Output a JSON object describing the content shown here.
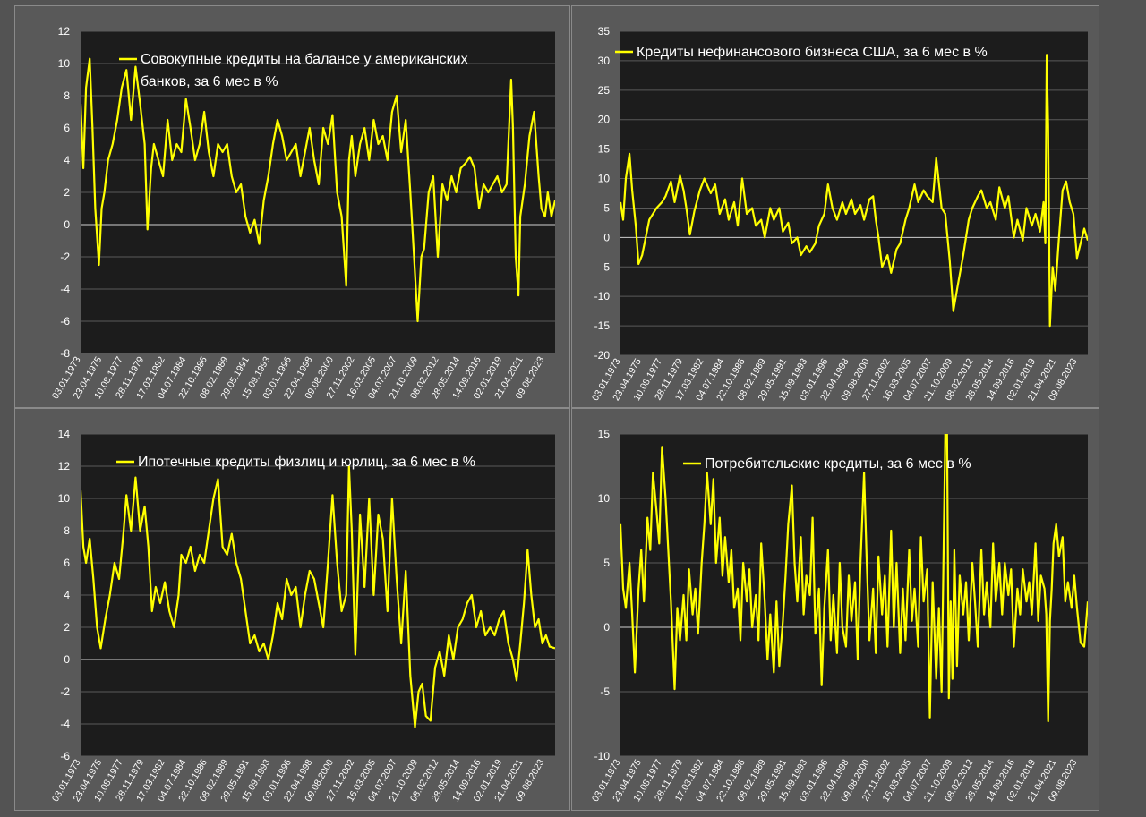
{
  "colors": {
    "series": "#ffff00",
    "plot_bg": "#1c1c1c",
    "grid": "#5a5a5a",
    "zero": "#cfcfcf",
    "text": "#ffffff"
  },
  "date_ticks": [
    "03.01.1973",
    "23.04.1975",
    "10.08.1977",
    "28.11.1979",
    "17.03.1982",
    "04.07.1984",
    "22.10.1986",
    "08.02.1989",
    "29.05.1991",
    "15.09.1993",
    "03.01.1996",
    "22.04.1998",
    "09.08.2000",
    "27.11.2002",
    "16.03.2005",
    "04.07.2007",
    "21.10.2009",
    "08.02.2012",
    "28.05.2014",
    "14.09.2016",
    "02.01.2019",
    "21.04.2021",
    "09.08.2023"
  ],
  "chart_data": [
    {
      "type": "line",
      "title_lines": [
        "Совокупные кредиты на балансе у американских",
        "банков, за 6 мес в %"
      ],
      "series_name": "Совокупные кредиты на балансе у американских банков, за 6 мес в %",
      "ylim": [
        -8,
        12
      ],
      "yticks": [
        -8,
        -6,
        -4,
        -2,
        0,
        2,
        4,
        6,
        8,
        10,
        12
      ],
      "x_range": [
        1973.0,
        2024.8
      ],
      "x": [
        1973.0,
        1973.3,
        1973.6,
        1974.0,
        1974.3,
        1974.6,
        1975.0,
        1975.3,
        1975.6,
        1976.0,
        1976.5,
        1977.0,
        1977.5,
        1978.0,
        1978.5,
        1979.0,
        1979.5,
        1980.0,
        1980.3,
        1980.7,
        1981.0,
        1981.5,
        1982.0,
        1982.5,
        1983.0,
        1983.5,
        1984.0,
        1984.5,
        1985.0,
        1985.5,
        1986.0,
        1986.5,
        1987.0,
        1987.5,
        1988.0,
        1988.5,
        1989.0,
        1989.5,
        1990.0,
        1990.5,
        1991.0,
        1991.5,
        1992.0,
        1992.5,
        1993.0,
        1993.5,
        1994.0,
        1994.5,
        1995.0,
        1995.5,
        1996.0,
        1996.5,
        1997.0,
        1997.5,
        1998.0,
        1998.5,
        1999.0,
        1999.5,
        2000.0,
        2000.5,
        2001.0,
        2001.5,
        2002.0,
        2002.3,
        2002.6,
        2003.0,
        2003.5,
        2004.0,
        2004.5,
        2005.0,
        2005.5,
        2006.0,
        2006.5,
        2007.0,
        2007.5,
        2008.0,
        2008.5,
        2009.0,
        2009.5,
        2009.8,
        2010.2,
        2010.5,
        2011.0,
        2011.5,
        2012.0,
        2012.5,
        2013.0,
        2013.5,
        2014.0,
        2014.5,
        2015.0,
        2015.5,
        2016.0,
        2016.5,
        2017.0,
        2017.5,
        2018.0,
        2018.5,
        2019.0,
        2019.5,
        2020.0,
        2020.2,
        2020.5,
        2020.8,
        2021.0,
        2021.5,
        2022.0,
        2022.5,
        2023.0,
        2023.3,
        2023.7,
        2024.0,
        2024.4,
        2024.8
      ],
      "y": [
        7.5,
        3.5,
        8.5,
        10.3,
        6.0,
        1.0,
        -2.5,
        1.0,
        2.0,
        4.0,
        5.0,
        6.5,
        8.5,
        9.6,
        6.5,
        9.8,
        7.5,
        5.0,
        -0.3,
        3.5,
        5.0,
        4.0,
        3.0,
        6.5,
        4.0,
        5.0,
        4.5,
        7.8,
        6.0,
        4.0,
        5.0,
        7.0,
        4.5,
        3.0,
        5.0,
        4.5,
        5.0,
        3.0,
        2.0,
        2.5,
        0.5,
        -0.5,
        0.3,
        -1.2,
        1.5,
        3.0,
        5.0,
        6.5,
        5.5,
        4.0,
        4.5,
        5.0,
        3.0,
        4.5,
        6.0,
        4.0,
        2.5,
        6.0,
        5.0,
        6.8,
        2.0,
        0.5,
        -3.8,
        4.0,
        5.5,
        3.0,
        5.0,
        6.0,
        4.0,
        6.5,
        5.0,
        5.5,
        4.0,
        7.0,
        8.0,
        4.5,
        6.5,
        2.0,
        -3.0,
        -6.0,
        -2.0,
        -1.5,
        2.0,
        3.0,
        -2.0,
        2.5,
        1.5,
        3.0,
        2.0,
        3.5,
        3.8,
        4.2,
        3.5,
        1.0,
        2.5,
        2.0,
        2.5,
        3.0,
        2.0,
        2.5,
        9.0,
        6.0,
        -2.0,
        -4.4,
        0.5,
        2.5,
        5.5,
        7.0,
        3.0,
        1.0,
        0.5,
        2.0,
        0.5,
        1.5
      ]
    },
    {
      "type": "line",
      "title_lines": [
        "Кредиты нефинансового бизнеса США, за 6 мес в %"
      ],
      "series_name": "Кредиты нефинансового бизнеса США, за 6 мес в %",
      "ylim": [
        -20,
        35
      ],
      "yticks": [
        -20,
        -15,
        -10,
        -5,
        0,
        5,
        10,
        15,
        20,
        25,
        30,
        35
      ],
      "x_range": [
        1973.0,
        2024.8
      ],
      "x": [
        1973.0,
        1973.3,
        1973.6,
        1974.0,
        1974.3,
        1974.7,
        1975.0,
        1975.4,
        1975.8,
        1976.2,
        1977.0,
        1977.6,
        1978.0,
        1978.6,
        1979.0,
        1979.6,
        1980.0,
        1980.3,
        1980.7,
        1981.2,
        1981.8,
        1982.3,
        1983.0,
        1983.5,
        1984.0,
        1984.6,
        1985.0,
        1985.6,
        1986.0,
        1986.5,
        1987.0,
        1987.6,
        1988.0,
        1988.6,
        1989.0,
        1989.6,
        1990.0,
        1990.6,
        1991.0,
        1991.6,
        1992.0,
        1992.6,
        1993.0,
        1993.6,
        1994.0,
        1994.6,
        1995.0,
        1995.6,
        1996.0,
        1996.5,
        1997.0,
        1997.6,
        1998.0,
        1998.6,
        1999.0,
        1999.6,
        2000.0,
        2000.6,
        2001.0,
        2001.3,
        2001.6,
        2002.0,
        2002.6,
        2003.0,
        2003.6,
        2004.0,
        2004.6,
        2005.0,
        2005.6,
        2006.0,
        2006.6,
        2007.0,
        2007.6,
        2008.0,
        2008.6,
        2009.0,
        2009.5,
        2009.9,
        2010.4,
        2011.0,
        2011.6,
        2012.0,
        2012.6,
        2013.0,
        2013.6,
        2014.0,
        2014.6,
        2015.0,
        2015.6,
        2016.0,
        2016.6,
        2017.0,
        2017.6,
        2018.0,
        2018.6,
        2019.0,
        2019.5,
        2019.9,
        2020.1,
        2020.25,
        2020.4,
        2020.6,
        2020.9,
        2021.2,
        2021.6,
        2022.0,
        2022.4,
        2022.8,
        2023.2,
        2023.6,
        2024.0,
        2024.4,
        2024.8
      ],
      "y": [
        6.0,
        3.0,
        10.0,
        14.2,
        8.0,
        2.0,
        -4.5,
        -3.0,
        0.0,
        3.0,
        5.0,
        6.0,
        7.0,
        9.5,
        6.0,
        10.5,
        8.0,
        5.0,
        0.5,
        4.5,
        8.0,
        10.0,
        7.5,
        9.0,
        4.0,
        6.5,
        3.0,
        6.0,
        2.0,
        10.0,
        4.0,
        5.0,
        2.0,
        3.0,
        0.0,
        5.0,
        3.0,
        5.0,
        1.0,
        2.5,
        -1.0,
        0.0,
        -3.0,
        -1.5,
        -2.5,
        -1.0,
        2.0,
        4.0,
        9.0,
        5.0,
        3.0,
        6.0,
        4.0,
        6.5,
        4.0,
        5.5,
        3.0,
        6.5,
        7.0,
        3.0,
        0.0,
        -5.0,
        -3.0,
        -6.0,
        -2.0,
        -1.0,
        3.0,
        5.0,
        9.0,
        6.0,
        8.0,
        7.0,
        6.0,
        13.5,
        5.0,
        4.0,
        -4.0,
        -12.5,
        -8.0,
        -3.0,
        3.0,
        5.0,
        7.0,
        8.0,
        5.0,
        6.0,
        3.0,
        8.5,
        5.0,
        7.0,
        0.0,
        3.0,
        -0.5,
        5.0,
        2.0,
        4.0,
        1.0,
        6.0,
        -1.0,
        31.0,
        19.0,
        -15.0,
        -5.0,
        -9.0,
        0.0,
        8.0,
        9.5,
        6.0,
        4.0,
        -3.5,
        -1.0,
        1.5,
        -0.5
      ]
    },
    {
      "type": "line",
      "title_lines": [
        "Ипотечные кредиты физлиц и юрлиц, за 6 мес в %"
      ],
      "series_name": "Ипотечные кредиты физлиц и юрлиц, за 6 мес в %",
      "ylim": [
        -6,
        14
      ],
      "yticks": [
        -6,
        -4,
        -2,
        0,
        2,
        4,
        6,
        8,
        10,
        12,
        14
      ],
      "x_range": [
        1973.0,
        2024.8
      ],
      "x": [
        1973.0,
        1973.3,
        1973.6,
        1974.0,
        1974.4,
        1974.8,
        1975.2,
        1975.7,
        1976.2,
        1976.7,
        1977.2,
        1977.7,
        1978.0,
        1978.5,
        1979.0,
        1979.5,
        1980.0,
        1980.4,
        1980.8,
        1981.2,
        1981.7,
        1982.2,
        1982.7,
        1983.2,
        1983.7,
        1984.0,
        1984.5,
        1985.0,
        1985.5,
        1986.0,
        1986.5,
        1987.0,
        1987.5,
        1988.0,
        1988.5,
        1989.0,
        1989.5,
        1990.0,
        1990.5,
        1991.0,
        1991.5,
        1992.0,
        1992.5,
        1993.0,
        1993.5,
        1994.0,
        1994.5,
        1995.0,
        1995.5,
        1996.0,
        1996.5,
        1997.0,
        1997.5,
        1998.0,
        1998.5,
        1999.0,
        1999.5,
        2000.0,
        2000.5,
        2001.0,
        2001.5,
        2002.0,
        2002.3,
        2002.6,
        2003.0,
        2003.5,
        2004.0,
        2004.5,
        2005.0,
        2005.5,
        2006.0,
        2006.5,
        2007.0,
        2007.5,
        2008.0,
        2008.5,
        2009.0,
        2009.5,
        2009.9,
        2010.3,
        2010.7,
        2011.2,
        2011.7,
        2012.2,
        2012.7,
        2013.2,
        2013.7,
        2014.2,
        2014.7,
        2015.2,
        2015.7,
        2016.2,
        2016.7,
        2017.2,
        2017.7,
        2018.2,
        2018.7,
        2019.2,
        2019.7,
        2020.2,
        2020.6,
        2021.0,
        2021.4,
        2021.8,
        2022.2,
        2022.6,
        2023.0,
        2023.4,
        2023.8,
        2024.2,
        2024.8
      ],
      "y": [
        10.5,
        7.0,
        6.0,
        7.5,
        5.0,
        2.0,
        0.7,
        2.5,
        4.0,
        6.0,
        5.0,
        8.0,
        10.2,
        8.0,
        11.3,
        8.0,
        9.5,
        7.0,
        3.0,
        4.5,
        3.5,
        4.8,
        3.0,
        2.0,
        4.0,
        6.5,
        6.0,
        7.0,
        5.5,
        6.5,
        6.0,
        8.0,
        10.0,
        11.2,
        7.0,
        6.5,
        7.8,
        6.0,
        5.0,
        3.0,
        1.0,
        1.5,
        0.5,
        1.0,
        0.0,
        1.5,
        3.5,
        2.5,
        5.0,
        4.0,
        4.5,
        2.0,
        4.0,
        5.5,
        5.0,
        3.5,
        2.0,
        6.0,
        10.2,
        6.0,
        3.0,
        4.0,
        12.0,
        8.0,
        0.3,
        9.0,
        4.5,
        10.0,
        4.0,
        9.0,
        7.5,
        3.0,
        10.0,
        5.0,
        1.0,
        5.5,
        -1.0,
        -4.2,
        -2.0,
        -1.5,
        -3.5,
        -3.8,
        -0.5,
        0.5,
        -1.0,
        1.5,
        0.0,
        2.0,
        2.5,
        3.5,
        4.0,
        2.0,
        3.0,
        1.5,
        2.0,
        1.5,
        2.5,
        3.0,
        1.0,
        0.0,
        -1.3,
        1.0,
        3.5,
        6.8,
        4.0,
        2.0,
        2.5,
        1.0,
        1.5,
        0.8,
        0.7
      ]
    },
    {
      "type": "line",
      "title_lines": [
        "Потребительские кредиты, за 6 мес в %"
      ],
      "series_name": "Потребительские кредиты, за 6 мес в %",
      "ylim": [
        -10,
        15
      ],
      "yticks": [
        -10,
        -5,
        0,
        5,
        10,
        15
      ],
      "x_range": [
        1973.0,
        2024.8
      ],
      "x": [
        1973.0,
        1973.3,
        1973.6,
        1974.0,
        1974.3,
        1974.6,
        1975.0,
        1975.3,
        1975.6,
        1976.0,
        1976.3,
        1976.6,
        1977.0,
        1977.3,
        1977.6,
        1978.0,
        1978.3,
        1978.6,
        1979.0,
        1979.3,
        1979.6,
        1980.0,
        1980.3,
        1980.6,
        1981.0,
        1981.3,
        1981.6,
        1982.0,
        1982.3,
        1982.6,
        1983.0,
        1983.3,
        1983.6,
        1984.0,
        1984.3,
        1984.6,
        1985.0,
        1985.3,
        1985.6,
        1986.0,
        1986.3,
        1986.6,
        1987.0,
        1987.3,
        1987.6,
        1988.0,
        1988.3,
        1988.6,
        1989.0,
        1989.3,
        1989.6,
        1990.0,
        1990.3,
        1990.6,
        1991.0,
        1991.3,
        1991.6,
        1992.0,
        1992.3,
        1992.6,
        1993.0,
        1993.3,
        1993.6,
        1994.0,
        1994.3,
        1994.6,
        1995.0,
        1995.3,
        1995.6,
        1996.0,
        1996.3,
        1996.6,
        1997.0,
        1997.3,
        1997.6,
        1998.0,
        1998.3,
        1998.6,
        1999.0,
        1999.3,
        1999.6,
        2000.0,
        2000.3,
        2000.6,
        2001.0,
        2001.3,
        2001.6,
        2002.0,
        2002.3,
        2002.6,
        2003.0,
        2003.3,
        2003.6,
        2004.0,
        2004.3,
        2004.6,
        2005.0,
        2005.3,
        2005.6,
        2006.0,
        2006.3,
        2006.6,
        2007.0,
        2007.3,
        2007.6,
        2008.0,
        2008.3,
        2008.6,
        2009.0,
        2009.2,
        2009.4,
        2009.6,
        2009.8,
        2010.0,
        2010.3,
        2010.6,
        2011.0,
        2011.3,
        2011.6,
        2012.0,
        2012.3,
        2012.6,
        2013.0,
        2013.3,
        2013.6,
        2014.0,
        2014.3,
        2014.6,
        2015.0,
        2015.3,
        2015.6,
        2016.0,
        2016.3,
        2016.6,
        2017.0,
        2017.3,
        2017.6,
        2018.0,
        2018.3,
        2018.6,
        2019.0,
        2019.3,
        2019.6,
        2020.0,
        2020.2,
        2020.4,
        2020.6,
        2020.8,
        2021.0,
        2021.3,
        2021.6,
        2022.0,
        2022.3,
        2022.6,
        2023.0,
        2023.3,
        2023.6,
        2024.0,
        2024.4,
        2024.8
      ],
      "y": [
        8.0,
        3.0,
        1.5,
        5.0,
        1.0,
        -3.5,
        3.0,
        6.0,
        2.0,
        8.5,
        6.0,
        12.0,
        9.0,
        6.5,
        14.0,
        10.0,
        6.0,
        2.0,
        -4.8,
        1.5,
        -1.0,
        2.5,
        -1.0,
        4.5,
        1.0,
        3.0,
        -0.5,
        5.0,
        8.0,
        12.0,
        8.0,
        11.5,
        5.0,
        8.5,
        4.0,
        7.0,
        3.5,
        6.0,
        1.5,
        3.0,
        -1.0,
        5.0,
        2.0,
        4.5,
        0.0,
        2.5,
        -1.0,
        6.5,
        2.0,
        -2.5,
        1.0,
        -3.5,
        2.0,
        -3.0,
        0.5,
        4.0,
        8.0,
        11.0,
        5.0,
        2.0,
        7.0,
        1.0,
        4.0,
        2.5,
        8.5,
        -0.5,
        3.0,
        -4.5,
        1.5,
        6.0,
        -1.0,
        2.5,
        -2.0,
        5.0,
        0.0,
        -1.5,
        4.0,
        0.5,
        3.5,
        -2.5,
        5.0,
        12.0,
        5.0,
        -1.0,
        3.0,
        -2.0,
        5.5,
        1.0,
        4.0,
        -1.5,
        7.5,
        0.0,
        5.0,
        -2.0,
        3.0,
        -1.0,
        6.0,
        0.5,
        3.0,
        -1.5,
        7.0,
        2.0,
        4.5,
        -7.0,
        3.5,
        -4.0,
        1.5,
        -5.0,
        15.0,
        15.0,
        -5.5,
        2.0,
        -4.0,
        6.0,
        -3.0,
        4.0,
        1.0,
        3.5,
        -1.0,
        5.0,
        2.0,
        -1.5,
        6.0,
        1.0,
        3.5,
        0.0,
        6.5,
        2.0,
        5.0,
        1.0,
        5.0,
        2.5,
        4.5,
        -1.5,
        3.0,
        1.0,
        4.5,
        2.0,
        3.5,
        1.0,
        6.5,
        0.5,
        4.0,
        3.0,
        1.0,
        -7.3,
        0.5,
        3.0,
        6.5,
        8.0,
        5.5,
        7.0,
        2.0,
        3.5,
        1.5,
        4.0,
        1.5,
        -1.2,
        -1.5,
        2.0
      ]
    }
  ]
}
